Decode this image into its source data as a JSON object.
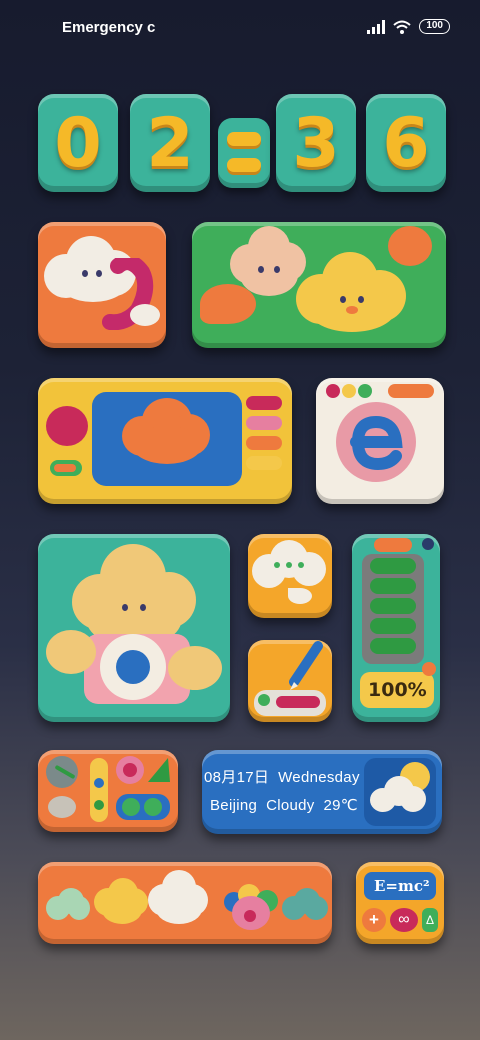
{
  "status_bar": {
    "carrier": "Emergency c",
    "signal_icon": "signal-icon",
    "wifi_icon": "wifi-icon",
    "battery": "100"
  },
  "clock": {
    "digits": [
      "0",
      "2",
      "3",
      "6"
    ],
    "separator": ":"
  },
  "weather": {
    "date": "08月17日",
    "weekday": "Wednesday",
    "city": "Beijing",
    "condition": "Cloudy",
    "temperature": "29℃",
    "icon": "cloudy-sun-icon"
  },
  "battery_widget": {
    "level": "100%",
    "fill_fraction": 1.0
  },
  "calculator": {
    "formula": "E=mc²",
    "plus": "+",
    "infinity": "∞",
    "delta": "Δ"
  },
  "colors": {
    "clock_tile": "#3cb39b",
    "clock_digit": "#f5b928",
    "accent_orange": "#ee7a3e",
    "accent_green": "#3fae5a",
    "accent_blue": "#2a6fc0"
  }
}
